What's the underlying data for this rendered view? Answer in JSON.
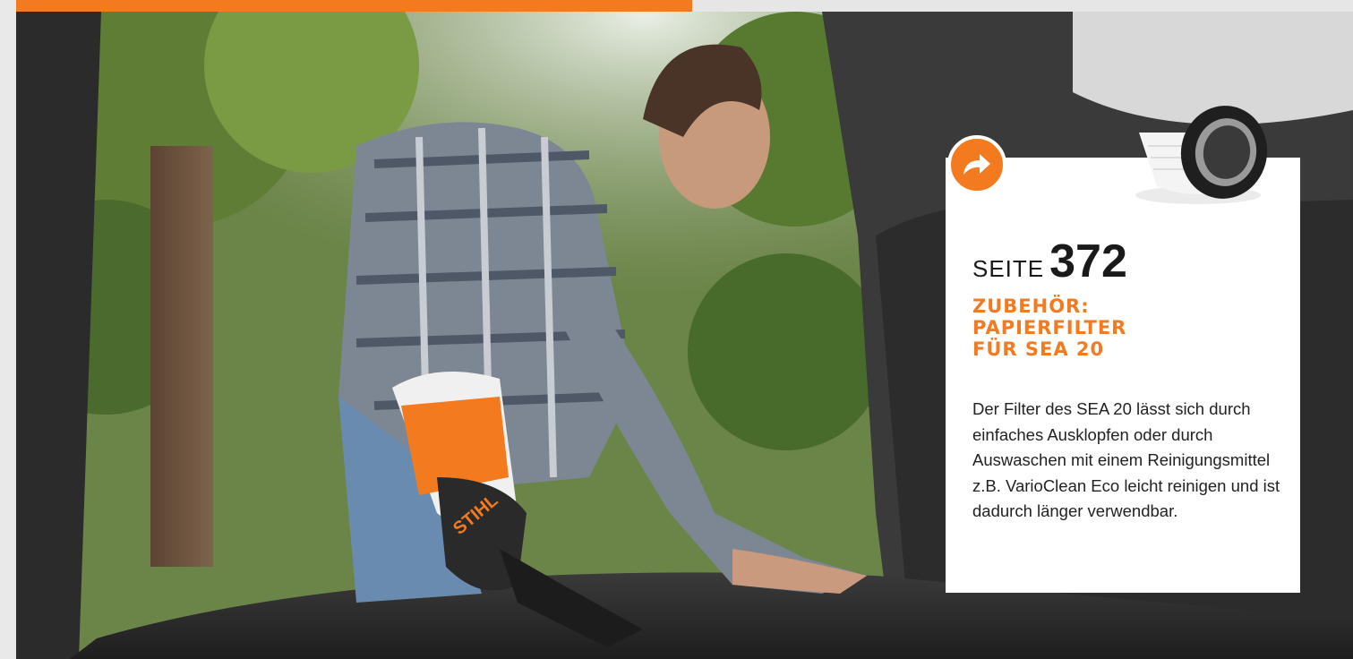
{
  "colors": {
    "accent": "#f37a1f",
    "card_bg": "#ffffff",
    "text": "#222222"
  },
  "header": {
    "bar_left": "orange",
    "bar_right": "light-grey"
  },
  "callout": {
    "icon": "arrow-right-icon",
    "page_prefix": "SEITE",
    "page_number": "372",
    "title_lines": [
      "ZUBEHÖR:",
      "PAPIERFILTER",
      "FÜR SEA 20"
    ],
    "body": "Der Filter des SEA 20 lässt sich durch einfaches Ausklopfen oder durch Auswaschen mit einem Reinigungsmittel z.B. VarioClean Eco leicht reinigen und ist dadurch länger verwendbar."
  },
  "photo": {
    "product_logo": "STIHL"
  }
}
